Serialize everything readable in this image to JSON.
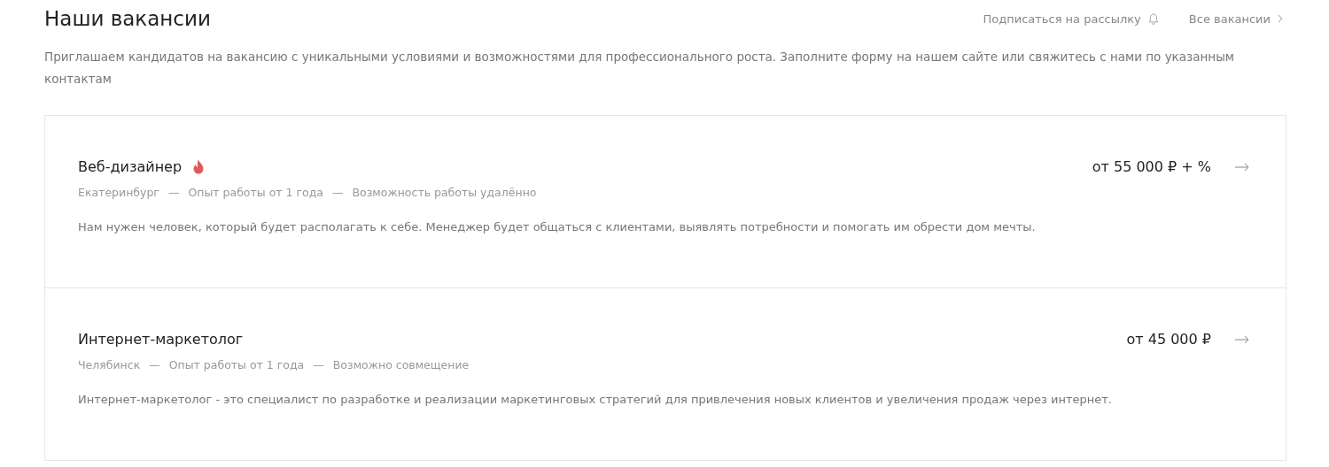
{
  "header": {
    "title": "Наши вакансии",
    "subscribe_link": "Подписаться на рассылку",
    "all_link": "Все вакансии"
  },
  "intro": "Приглашаем кандидатов на вакансию с уникальными условиями и возможностями для профессионального роста. Заполните форму на нашем сайте или свяжитесь с нами по указанным контактам",
  "meta_separator": "—",
  "vacancies": [
    {
      "title": "Веб-дизайнер",
      "hot": true,
      "salary": "от 55 000 ₽ + %",
      "meta": [
        "Екатеринбург",
        "Опыт работы от 1 года",
        "Возможность работы удалённо"
      ],
      "description": "Нам нужен человек, который будет располагать к себе. Менеджер будет общаться с клиентами, выявлять потребности и помогать им обрести дом мечты."
    },
    {
      "title": "Интернет-маркетолог",
      "hot": false,
      "salary": "от 45 000 ₽",
      "meta": [
        "Челябинск",
        "Опыт работы от 1 года",
        "Возможно совмещение"
      ],
      "description": "Интернет-маркетолог - это специалист по разработке и реализации маркетинговых стратегий для привлечения новых клиентов и увеличения продаж через интернет."
    }
  ]
}
